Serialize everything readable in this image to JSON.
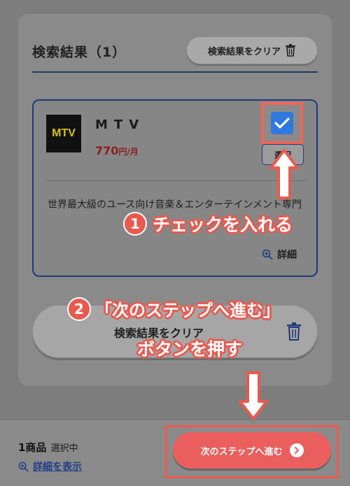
{
  "results": {
    "title": "検索結果（1）",
    "clear_label": "検索結果をクリア"
  },
  "card": {
    "logo": "MTV",
    "channel": "MTV",
    "price": "770",
    "price_unit": "円/月",
    "select_label": "選択",
    "description": "世界最大級のユース向け音楽＆エンターテインメント専門",
    "detail_label": "詳細",
    "checked": true
  },
  "bottom_clear_label": "検索結果をクリア",
  "footer": {
    "count": "1商品",
    "count_sub": "選択中",
    "show_detail": "詳細を表示",
    "next_label": "次のステップへ進む"
  },
  "annotations": {
    "step1_num": "1",
    "step1": "チェックを入れる",
    "step2_num": "2",
    "step2_line1": "「次のステップへ進む」",
    "step2_line2": "ボタンを押す"
  },
  "colors": {
    "accent_red": "#e85a50",
    "checkbox_blue": "#2f78e0",
    "navy": "#1e3b7a",
    "next_button": "#ea5e5e"
  },
  "icons": [
    "trash-icon",
    "check-icon",
    "zoom-in-icon",
    "chevron-right-icon",
    "up-arrow-icon",
    "down-arrow-icon"
  ]
}
